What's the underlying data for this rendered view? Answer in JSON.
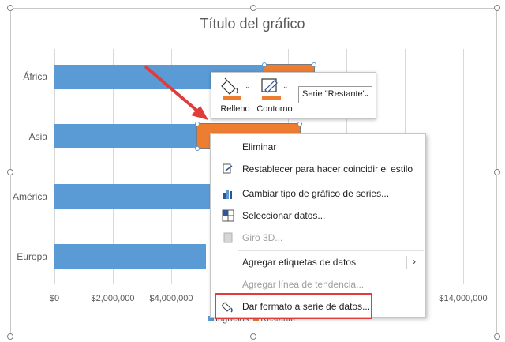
{
  "chart": {
    "title": "Título del gráfico",
    "categories": [
      "África",
      "Asia",
      "América",
      "Europa"
    ],
    "x_ticks": [
      "$0",
      "$2,000,000",
      "$4,000,000",
      "$14,000,000"
    ],
    "legend": [
      "Ingresos",
      "Restante"
    ],
    "colors": {
      "ingresos": "#5b9bd5",
      "restante": "#ed7d31"
    }
  },
  "chart_data": {
    "type": "bar",
    "title": "Título del gráfico",
    "orientation": "horizontal",
    "stacked": true,
    "categories": [
      "África",
      "Asia",
      "América",
      "Europa"
    ],
    "series": [
      {
        "name": "Ingresos",
        "values": [
          7200000,
          4900000,
          7000000,
          5200000
        ]
      },
      {
        "name": "Restante",
        "values": [
          1700000,
          3500000,
          null,
          null
        ]
      }
    ],
    "xlim": [
      0,
      14000000
    ],
    "grid": true,
    "legend_position": "bottom"
  },
  "toolbar": {
    "fill_label": "Relleno",
    "outline_label": "Contorno",
    "series_select": "Serie \"Restante\""
  },
  "menu": {
    "items": [
      {
        "label": "Eliminar",
        "icon": "none",
        "disabled": false
      },
      {
        "label": "Restablecer para hacer coincidir el estilo",
        "icon": "reset-style-icon",
        "disabled": false
      },
      {
        "label": "Cambiar tipo de gráfico de series...",
        "icon": "chart-type-icon",
        "disabled": false
      },
      {
        "label": "Seleccionar datos...",
        "icon": "select-data-icon",
        "disabled": false
      },
      {
        "label": "Giro 3D...",
        "icon": "rotation-3d-icon",
        "disabled": true
      },
      {
        "label": "Agregar etiquetas de datos",
        "icon": "none",
        "disabled": false
      },
      {
        "label": "Agregar línea de tendencia...",
        "icon": "none",
        "disabled": true
      },
      {
        "label": "Dar formato a serie de datos...",
        "icon": "format-series-icon",
        "disabled": false
      }
    ]
  }
}
